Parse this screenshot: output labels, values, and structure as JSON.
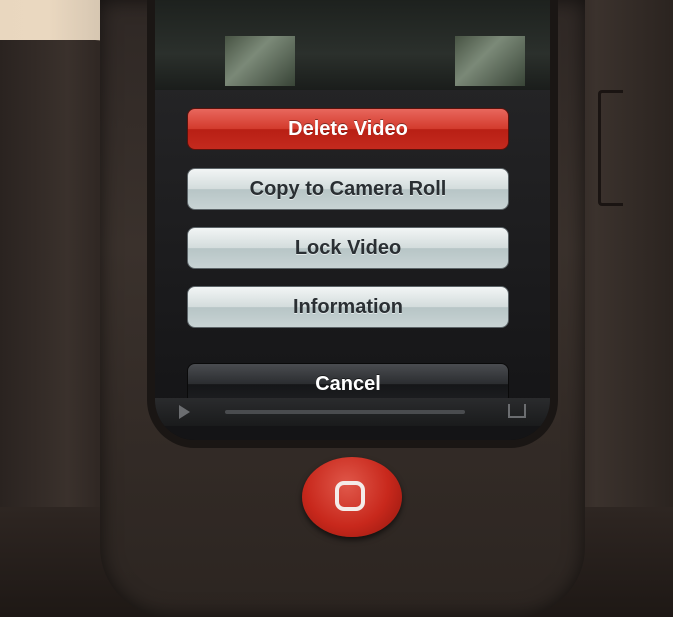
{
  "action_sheet": {
    "delete_label": "Delete Video",
    "copy_label": "Copy to Camera Roll",
    "lock_label": "Lock Video",
    "info_label": "Information",
    "cancel_label": "Cancel"
  },
  "colors": {
    "destructive": "#d33a2c",
    "default_button": "#d3dcdc",
    "cancel_button": "#2b2d30",
    "home_button": "#c8281c"
  },
  "icons": {
    "play": "play-icon",
    "share": "share-icon",
    "home": "home-button-icon"
  }
}
